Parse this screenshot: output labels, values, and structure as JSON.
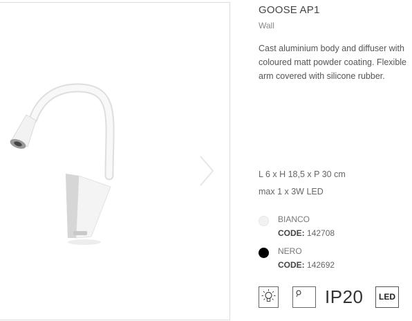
{
  "gallery": {
    "product_image": "white-wall-lamp-gooseneck",
    "next_icon": "chevron-right-icon"
  },
  "product": {
    "title": "GOOSE AP1",
    "subtitle": "Wall",
    "description": "Cast aluminium body and diffuser with coloured matt powder coating. Flexible arm covered with silicone rubber.",
    "dimensions": "L 6 x H 18,5 x P 30 cm",
    "power": "max 1 x 3W LED"
  },
  "variants": [
    {
      "name": "BIANCO",
      "code_label": "CODE:",
      "code": "142708",
      "color": "#f2f2f2"
    },
    {
      "name": "NERO",
      "code_label": "CODE:",
      "code": "142692",
      "color": "#000000"
    }
  ],
  "badges": {
    "bulb_icon": "bulb-icon",
    "spot_icon": "spotlight-icon",
    "ip_rating": "IP20",
    "led_label": "LED"
  },
  "colors": {
    "border": "#dcdcdc",
    "text": "#555555",
    "title": "#444444"
  }
}
